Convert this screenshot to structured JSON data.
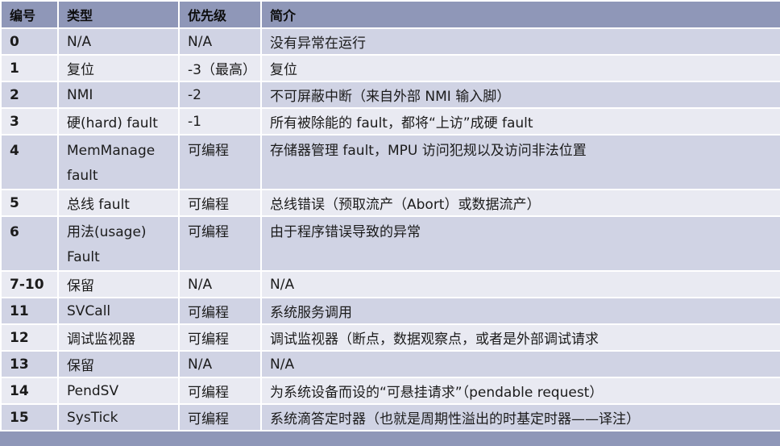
{
  "headers": [
    "编号",
    "类型",
    "优先级",
    "简介"
  ],
  "rows": [
    {
      "num": "0",
      "type": "N/A",
      "priority": "N/A",
      "desc": "没有异常在运行"
    },
    {
      "num": "1",
      "type": "复位",
      "priority": "-3（最高）",
      "desc": "复位"
    },
    {
      "num": "2",
      "type": "NMI",
      "priority": "-2",
      "desc": "不可屏蔽中断（来自外部 NMI 输入脚）"
    },
    {
      "num": "3",
      "type": "硬(hard) fault",
      "priority": "-1",
      "desc": "所有被除能的 fault，都将“上访”成硬 fault"
    },
    {
      "num": "4",
      "type": "MemManage fault",
      "priority": "可编程",
      "desc": "存储器管理 fault，MPU 访问犯规以及访问非法位置"
    },
    {
      "num": "5",
      "type": "总线 fault",
      "priority": "可编程",
      "desc": "总线错误（预取流产（Abort）或数据流产）"
    },
    {
      "num": "6",
      "type": "用法(usage) Fault",
      "priority": "可编程",
      "desc": "由于程序错误导致的异常"
    },
    {
      "num": "7-10",
      "type": "保留",
      "priority": "N/A",
      "desc": "N/A"
    },
    {
      "num": "11",
      "type": "SVCall",
      "priority": "可编程",
      "desc": "系统服务调用"
    },
    {
      "num": "12",
      "type": "调试监视器",
      "priority": "可编程",
      "desc": "调试监视器（断点，数据观察点，或者是外部调试请求"
    },
    {
      "num": "13",
      "type": "保留",
      "priority": "N/A",
      "desc": "N/A"
    },
    {
      "num": "14",
      "type": "PendSV",
      "priority": "可编程",
      "desc": "为系统设备而设的“可悬挂请求”（pendable request）"
    },
    {
      "num": "15",
      "type": "SysTick",
      "priority": "可编程",
      "desc": "系统滴答定时器（也就是周期性溢出的时基定时器——译注）"
    }
  ]
}
